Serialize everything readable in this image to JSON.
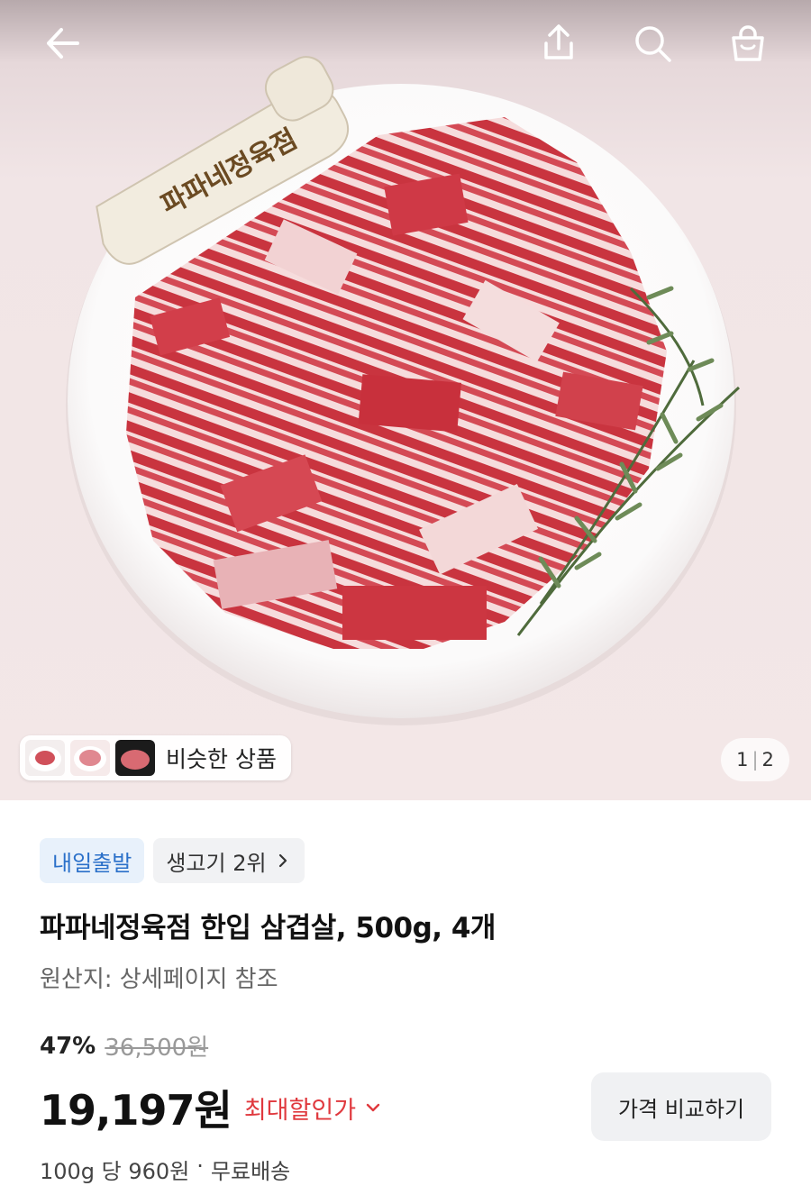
{
  "hero": {
    "similar_label": "비슷한 상품",
    "counter_current": "1",
    "counter_sep": "|",
    "counter_total": "2",
    "logo_text": "파파네정육점"
  },
  "topbar": {
    "icons": [
      "back-arrow-icon",
      "share-icon",
      "search-icon",
      "shopping-bag-icon"
    ]
  },
  "badges": {
    "delivery": "내일출발",
    "rank": "생고기 2위"
  },
  "product": {
    "title": "파파네정육점 한입 삼겹살, 500g, 4개",
    "origin": "원산지: 상세페이지 참조",
    "discount_pct": "47%",
    "original_price": "36,500원",
    "price": "19,197원",
    "max_discount_label": "최대할인가",
    "compare_button": "가격 비교하기",
    "unit_price": "100g 당 960원",
    "separator": "·",
    "shipping": "무료배송"
  },
  "colors": {
    "accent_red": "#e0393e",
    "badge_blue": "#2a70c9"
  }
}
